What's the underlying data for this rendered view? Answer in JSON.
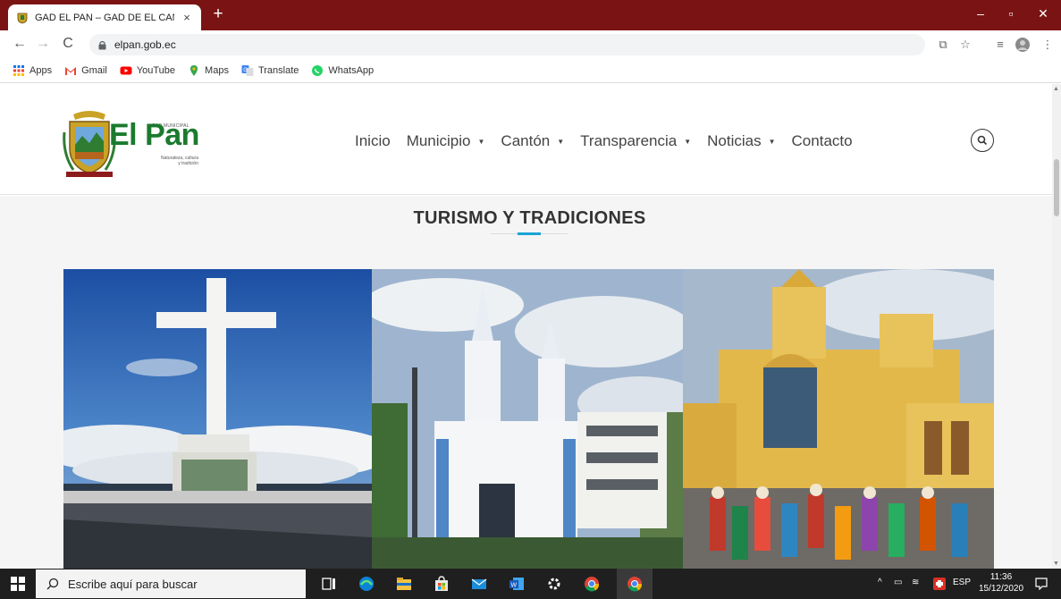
{
  "browser": {
    "tab": {
      "title": "GAD EL PAN – GAD DE EL CANTÓ",
      "close_glyph": "×"
    },
    "new_tab_glyph": "+",
    "window_controls": {
      "minimize": "–",
      "maximize": "▫",
      "close": "✕"
    },
    "address": {
      "url": "elpan.gob.ec"
    },
    "bookmarks": [
      {
        "label": "Apps",
        "icon": "apps-grid-icon"
      },
      {
        "label": "Gmail",
        "icon": "gmail-icon"
      },
      {
        "label": "YouTube",
        "icon": "youtube-icon"
      },
      {
        "label": "Maps",
        "icon": "maps-icon"
      },
      {
        "label": "Translate",
        "icon": "translate-icon"
      },
      {
        "label": "WhatsApp",
        "icon": "whatsapp-icon"
      }
    ]
  },
  "site": {
    "logo": {
      "small_text": "GAD MUNICIPAL",
      "name": "El Pan",
      "tagline_1": "Naturaleza, cultura",
      "tagline_2": "y tradición"
    },
    "nav": [
      {
        "label": "Inicio",
        "dropdown": false
      },
      {
        "label": "Municipio",
        "dropdown": true
      },
      {
        "label": "Cantón",
        "dropdown": true
      },
      {
        "label": "Transparencia",
        "dropdown": true
      },
      {
        "label": "Noticias",
        "dropdown": true
      },
      {
        "label": "Contacto",
        "dropdown": false
      }
    ],
    "section": {
      "title": "TURISMO Y TRADICIONES"
    },
    "gallery": [
      {
        "subject": "cross-monument-photo"
      },
      {
        "subject": "church-photo"
      },
      {
        "subject": "church-festival-photo"
      }
    ]
  },
  "taskbar": {
    "search_placeholder": "Escribe aquí para buscar",
    "language": "ESP",
    "time": "11:36",
    "date": "15/12/2020"
  },
  "colors": {
    "titlebar": "#7a1414",
    "logo_green": "#1b7a2e",
    "accent_blue": "#1aa3d6",
    "taskbar": "#1f1f1f"
  }
}
